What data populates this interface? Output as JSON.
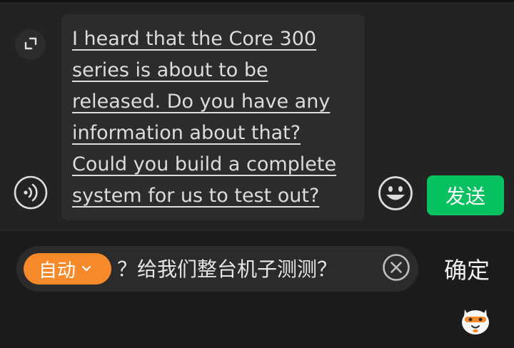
{
  "compose": {
    "message": "I heard that the Core 300 series is about to be released. Do you have any information about that? Could you build a complete system for us to test out?",
    "send_label": "发送"
  },
  "translate": {
    "mode_label": "自动",
    "result_text": "？给我们整台机子测测？",
    "confirm_label": "确定"
  },
  "icons": {
    "expand": "expand-icon",
    "voice": "voice-icon",
    "emoji": "emoji-icon",
    "chevron": "chevron-down-icon",
    "clear": "clear-icon",
    "mascot": "mascot-icon"
  },
  "colors": {
    "send_button": "#07c160",
    "mode_chip": "#f68a2b",
    "background": "#1f1f1f",
    "message_box": "#2c2c2c"
  }
}
